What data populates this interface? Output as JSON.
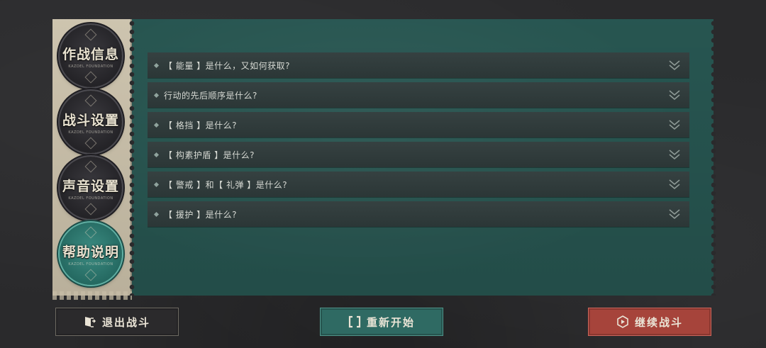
{
  "sidebar": {
    "tabs": [
      {
        "label": "作战信息",
        "sub": "KAZDEL FOUNDATION",
        "active": false
      },
      {
        "label": "战斗设置",
        "sub": "KAZDEL FOUNDATION",
        "active": false
      },
      {
        "label": "声音设置",
        "sub": "KAZDEL FOUNDATION",
        "active": false
      },
      {
        "label": "帮助说明",
        "sub": "KAZDEL FOUNDATION",
        "active": true
      }
    ]
  },
  "faq": {
    "items": [
      {
        "text": "【 能量 】是什么，又如何获取?"
      },
      {
        "text": "行动的先后顺序是什么?"
      },
      {
        "text": "【 格挡 】是什么?"
      },
      {
        "text": "【 构素护盾 】是什么?"
      },
      {
        "text": "【 警戒 】和【 礼弹 】是什么?"
      },
      {
        "text": "【 援护 】是什么?"
      }
    ]
  },
  "footer": {
    "exit_label": "退出战斗",
    "restart_label": "重新开始",
    "continue_label": "继续战斗"
  },
  "icons": {
    "exit": "exit-door-icon",
    "restart": "restart-brackets-icon",
    "continue": "play-hexagon-icon",
    "expand": "chevron-double-down-icon",
    "bullet": "diamond-bullet-icon"
  },
  "colors": {
    "panel": "#295a55",
    "tab_active": "#2f7a71",
    "restart_button": "#2f6a63",
    "continue_button": "#a6443b",
    "faq_row": "#2f3b3b"
  }
}
